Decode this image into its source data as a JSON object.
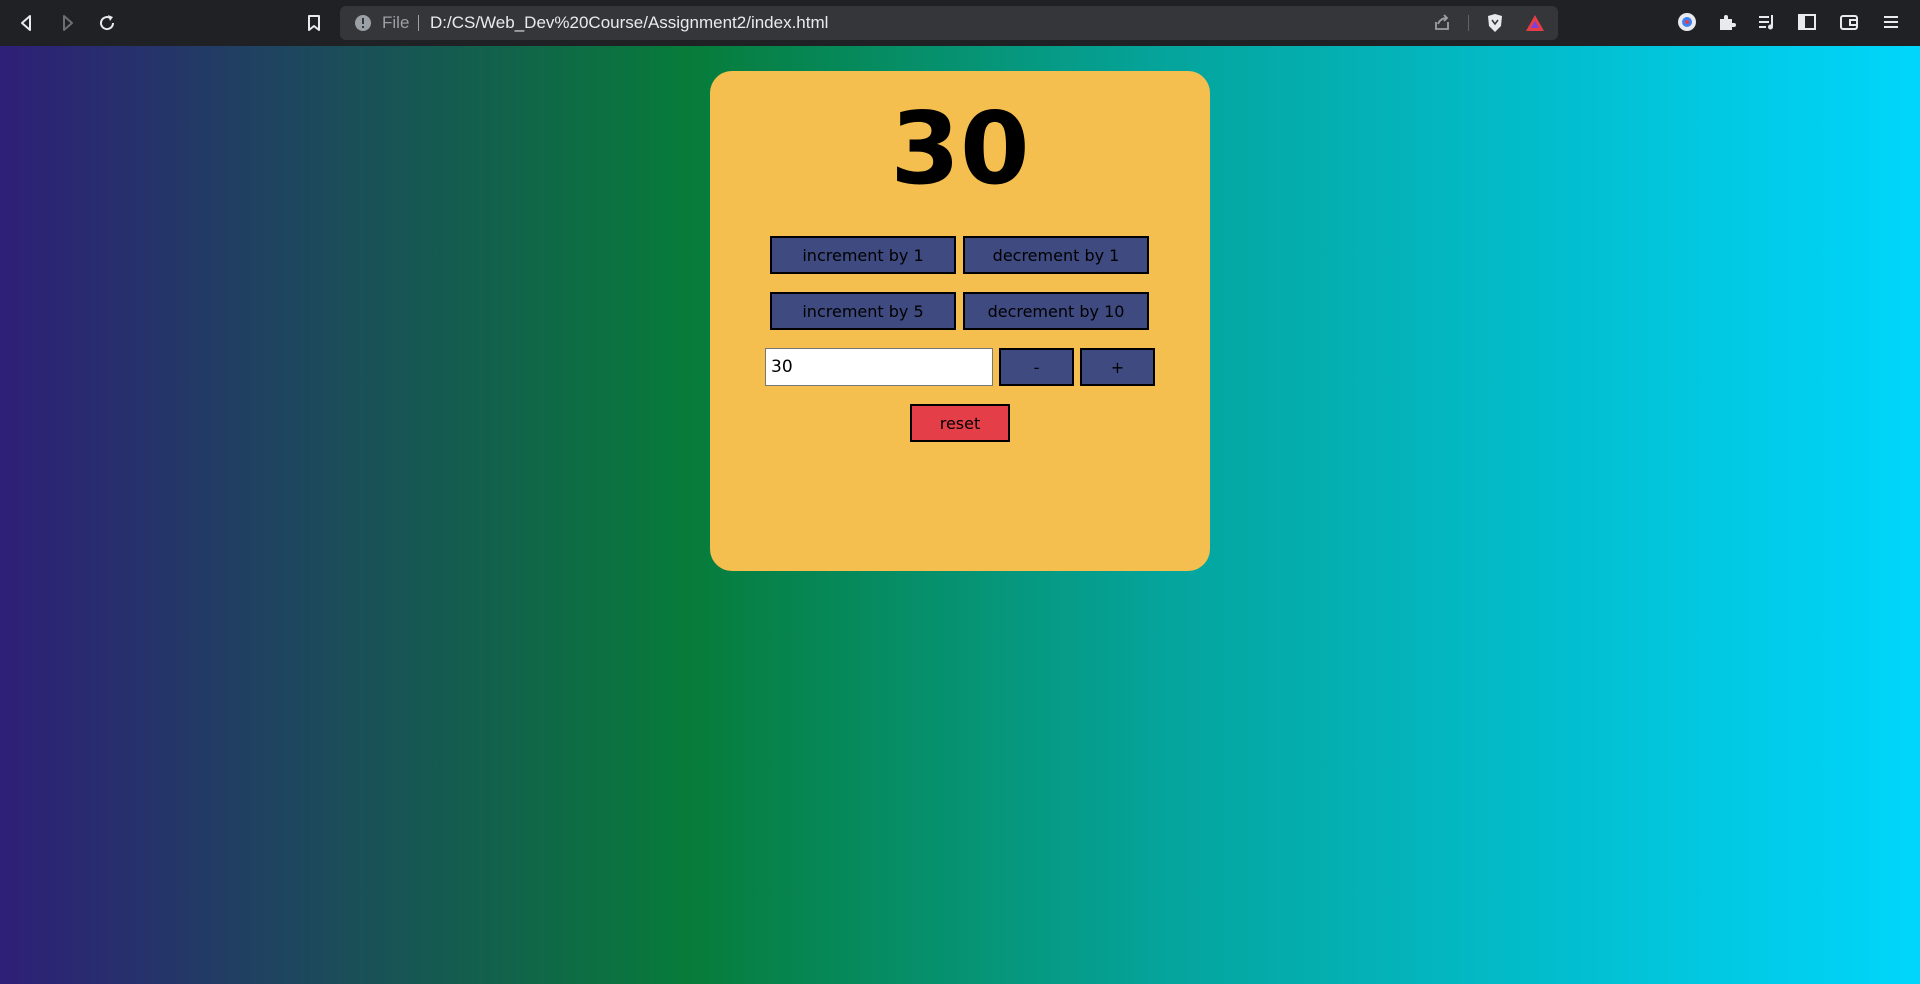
{
  "browser": {
    "url_label": "File",
    "url": "D:/CS/Web_Dev%20Course/Assignment2/index.html"
  },
  "counter": {
    "value": "30"
  },
  "buttons": {
    "increment_1": "increment by 1",
    "decrement_1": "decrement by 1",
    "increment_5": "increment by 5",
    "decrement_10": "decrement by 10",
    "minus": "-",
    "plus": "+",
    "reset": "reset"
  },
  "input": {
    "value": "30"
  },
  "colors": {
    "card": "#f5bf4f",
    "button": "#3e4a80",
    "reset": "#e43f48"
  }
}
